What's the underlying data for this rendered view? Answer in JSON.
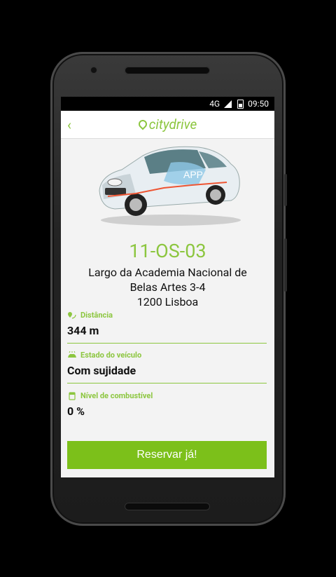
{
  "status": {
    "network": "4G",
    "time": "09:50"
  },
  "header": {
    "back_label": "‹",
    "logo_text": "citydrive"
  },
  "car": {
    "plate": "11-OS-03",
    "decal_text": "APP"
  },
  "address": {
    "line1": "Largo da Academia Nacional de",
    "line2": "Belas Artes 3-4",
    "line3": "1200 Lisboa"
  },
  "fields": [
    {
      "label": "Distância",
      "value": "344 m",
      "icon": "route-pin-icon"
    },
    {
      "label": "Estado do veículo",
      "value": "Com sujidade",
      "icon": "car-wash-icon"
    },
    {
      "label": "Nível de combustível",
      "value": "0 %",
      "icon": "fuel-tank-icon"
    }
  ],
  "action": {
    "reserve_label": "Reservar já!"
  },
  "colors": {
    "accent": "#8cc63f",
    "button": "#7cc01a"
  }
}
